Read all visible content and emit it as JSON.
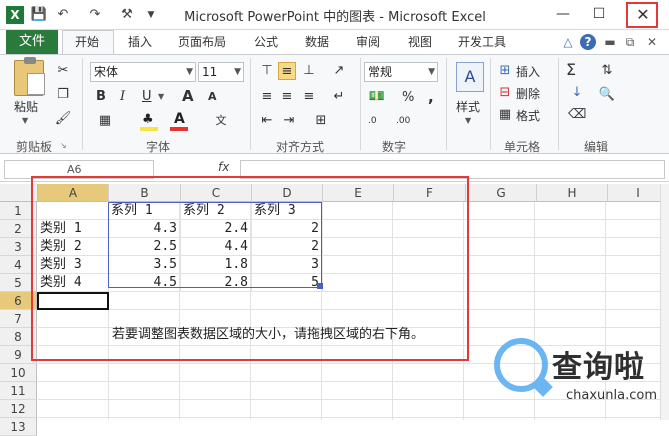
{
  "window": {
    "title": "Microsoft PowerPoint 中的图表 - Microsoft Excel",
    "minimize_glyph": "—",
    "maximize_glyph": "☐",
    "close_glyph": "✕"
  },
  "quick_access": [
    "save-icon",
    "undo-icon",
    "redo-icon",
    "customize-icon"
  ],
  "ribbon_tabs": {
    "file": "文件",
    "home": "开始",
    "insert": "插入",
    "page_layout": "页面布局",
    "formulas": "公式",
    "data": "数据",
    "review": "审阅",
    "view": "视图",
    "developer": "开发工具"
  },
  "ribbon": {
    "clipboard": {
      "label": "剪贴板",
      "paste": "粘贴"
    },
    "font": {
      "label": "字体",
      "font_name": "宋体",
      "font_size": "11",
      "bold": "B",
      "italic": "I",
      "underline": "U",
      "grow": "A",
      "shrink": "A",
      "accent_color": "#e8322b",
      "highlight_color": "#f5e442"
    },
    "alignment": {
      "label": "对齐方式"
    },
    "number": {
      "label": "数字",
      "format": "常规",
      "percent": "%",
      "comma": ",",
      "inc_decimal": ".0",
      "dec_decimal": ".00"
    },
    "styles": {
      "label": "样式",
      "button": "样式"
    },
    "cells": {
      "label": "单元格",
      "insert": "插入",
      "delete": "删除",
      "format": "格式"
    },
    "editing": {
      "label": "编辑",
      "sum": "Σ"
    }
  },
  "formula_bar": {
    "name_box": "A6",
    "fx": "fx"
  },
  "columns": [
    "A",
    "B",
    "C",
    "D",
    "E",
    "F",
    "G",
    "H",
    "I"
  ],
  "rows": [
    "1",
    "2",
    "3",
    "4",
    "5",
    "6",
    "7",
    "8",
    "9",
    "10",
    "11",
    "12",
    "13"
  ],
  "sheet": {
    "header": [
      "",
      "系列 1",
      "系列 2",
      "系列 3"
    ],
    "data": [
      [
        "类别 1",
        "4.3",
        "2.4",
        "2"
      ],
      [
        "类别 2",
        "2.5",
        "4.4",
        "2"
      ],
      [
        "类别 3",
        "3.5",
        "1.8",
        "3"
      ],
      [
        "类别 4",
        "4.5",
        "2.8",
        "5"
      ]
    ],
    "note": "若要调整图表数据区域的大小，请拖拽区域的右下角。"
  },
  "highlight_color": "#e23a3a",
  "watermark": {
    "text": "查询啦",
    "sub": "chaxunla.com",
    "color": "#6bb6f2"
  }
}
